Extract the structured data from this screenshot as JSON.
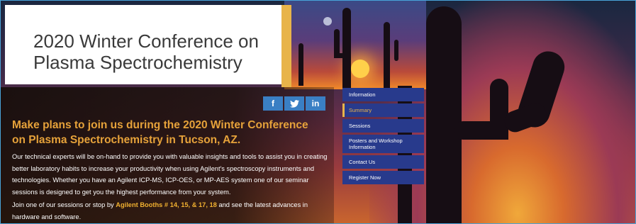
{
  "title": {
    "line1": "2020 Winter Conference on",
    "line2": "Plasma Spectrochemistry"
  },
  "social": [
    {
      "name": "facebook",
      "glyph": "f"
    },
    {
      "name": "twitter",
      "glyph": "🐦"
    },
    {
      "name": "linkedin",
      "glyph": "in"
    }
  ],
  "headline": "Make plans to join us during the 2020 Winter Conference on Plasma Spectrochemistry in Tucson, AZ.",
  "body": {
    "paragraph1": "Our technical experts will be on-hand to provide you with valuable insights and tools to assist you in creating better laboratory habits to increase your productivity when using Agilent's spectroscopy instruments and technologies. Whether you have an Agilent ICP-MS, ICP-OES, or MP-AES system one of our seminar sessions is designed to get you the highest performance from your system.",
    "paragraph2_prefix": "Join one of our sessions or stop by ",
    "paragraph2_booths": "Agilent Booths # 14, 15, & 17, 18",
    "paragraph2_suffix": " and see the latest advances in hardware and software."
  },
  "nav": {
    "items": [
      {
        "label": "Information"
      },
      {
        "label": "Summary",
        "active": true
      },
      {
        "label": "Sessions"
      },
      {
        "label": "Posters and Workshop Information"
      },
      {
        "label": "Contact Us"
      },
      {
        "label": "Register Now"
      }
    ]
  },
  "colors": {
    "accent": "#e8b44a",
    "nav_bg": "#283a8c",
    "social_bg": "#3a7fc4",
    "border": "#49a3d8"
  }
}
